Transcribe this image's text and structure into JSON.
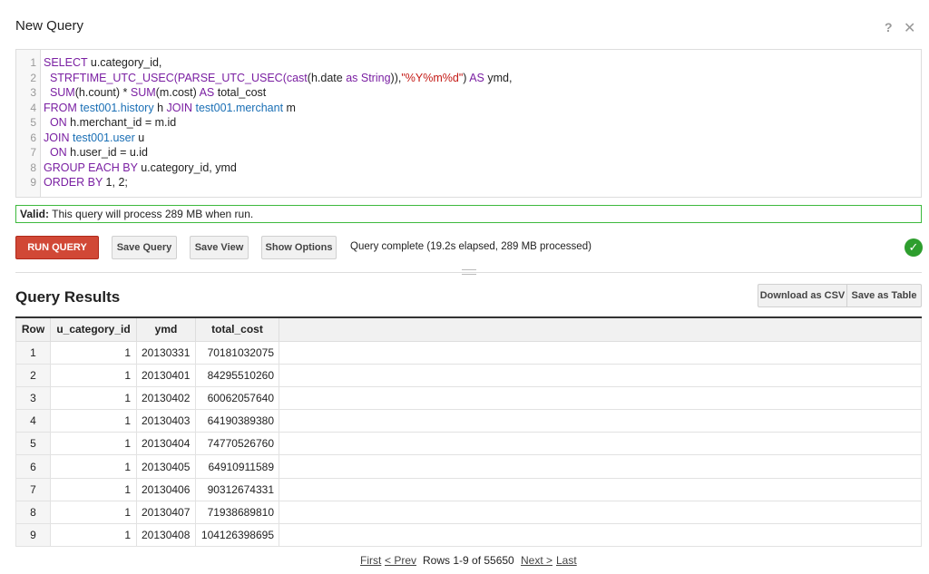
{
  "header": {
    "title": "New Query",
    "help_glyph": "?",
    "close_glyph": "✕"
  },
  "editor": {
    "line_numbers": [
      "1",
      "2",
      "3",
      "4",
      "5",
      "6",
      "7",
      "8",
      "9"
    ],
    "lines": [
      [
        {
          "t": "SELECT",
          "c": "kw"
        },
        {
          "t": " u.category_id,",
          "c": ""
        }
      ],
      [
        {
          "t": "  STRFTIME_UTC_USEC(PARSE_UTC_USEC(",
          "c": "kw"
        },
        {
          "t": "cast",
          "c": "kw"
        },
        {
          "t": "(h.date ",
          "c": ""
        },
        {
          "t": "as String",
          "c": "kw"
        },
        {
          "t": ")),",
          "c": ""
        },
        {
          "t": "\"%Y%m%d\"",
          "c": "str"
        },
        {
          "t": ") ",
          "c": ""
        },
        {
          "t": "AS",
          "c": "kw"
        },
        {
          "t": " ymd,",
          "c": ""
        }
      ],
      [
        {
          "t": "  SUM",
          "c": "kw"
        },
        {
          "t": "(h.count) * ",
          "c": ""
        },
        {
          "t": "SUM",
          "c": "kw"
        },
        {
          "t": "(m.cost) ",
          "c": ""
        },
        {
          "t": "AS",
          "c": "kw"
        },
        {
          "t": " total_cost",
          "c": ""
        }
      ],
      [
        {
          "t": "FROM",
          "c": "kw"
        },
        {
          "t": " ",
          "c": ""
        },
        {
          "t": "test001.history",
          "c": "tbl"
        },
        {
          "t": " h ",
          "c": ""
        },
        {
          "t": "JOIN",
          "c": "kw"
        },
        {
          "t": " ",
          "c": ""
        },
        {
          "t": "test001.merchant",
          "c": "tbl"
        },
        {
          "t": " m",
          "c": ""
        }
      ],
      [
        {
          "t": "  ON",
          "c": "kw"
        },
        {
          "t": " h.merchant_id = m.id",
          "c": ""
        }
      ],
      [
        {
          "t": "JOIN",
          "c": "kw"
        },
        {
          "t": " ",
          "c": ""
        },
        {
          "t": "test001.user",
          "c": "tbl"
        },
        {
          "t": " u",
          "c": ""
        }
      ],
      [
        {
          "t": "  ON",
          "c": "kw"
        },
        {
          "t": " h.user_id = u.id",
          "c": ""
        }
      ],
      [
        {
          "t": "GROUP EACH BY",
          "c": "kw"
        },
        {
          "t": " u.category_id, ymd",
          "c": ""
        }
      ],
      [
        {
          "t": "ORDER BY",
          "c": "kw"
        },
        {
          "t": " 1, 2;",
          "c": ""
        }
      ]
    ]
  },
  "validation": {
    "label": "Valid:",
    "message": " This query will process 289 MB when run."
  },
  "toolbar": {
    "run_label": "RUN QUERY",
    "save_query_label": "Save Query",
    "save_view_label": "Save View",
    "show_options_label": "Show Options",
    "status": "Query complete (19.2s elapsed, 289 MB processed)",
    "ok_glyph": "✓"
  },
  "results": {
    "title": "Query Results",
    "download_csv_label": "Download as CSV",
    "save_table_label": "Save as Table",
    "columns": [
      "Row",
      "u_category_id",
      "ymd",
      "total_cost"
    ],
    "rows": [
      [
        "1",
        "1",
        "20130331",
        "70181032075"
      ],
      [
        "2",
        "1",
        "20130401",
        "84295510260"
      ],
      [
        "3",
        "1",
        "20130402",
        "60062057640"
      ],
      [
        "4",
        "1",
        "20130403",
        "64190389380"
      ],
      [
        "5",
        "1",
        "20130404",
        "74770526760"
      ],
      [
        "6",
        "1",
        "20130405",
        "64910911589"
      ],
      [
        "7",
        "1",
        "20130406",
        "90312674331"
      ],
      [
        "8",
        "1",
        "20130407",
        "71938689810"
      ],
      [
        "9",
        "1",
        "20130408",
        "104126398695"
      ]
    ]
  },
  "pager": {
    "first": "First",
    "prev": "< Prev",
    "info": "Rows 1-9 of 55650",
    "next": "Next >",
    "last": "Last"
  },
  "colors": {
    "run_button": "#d14836",
    "valid_border": "#3db93d",
    "ok_icon": "#2e9e2e",
    "keyword": "#7a1fa2",
    "table_ref": "#1a6fb5",
    "string": "#c41a16"
  }
}
